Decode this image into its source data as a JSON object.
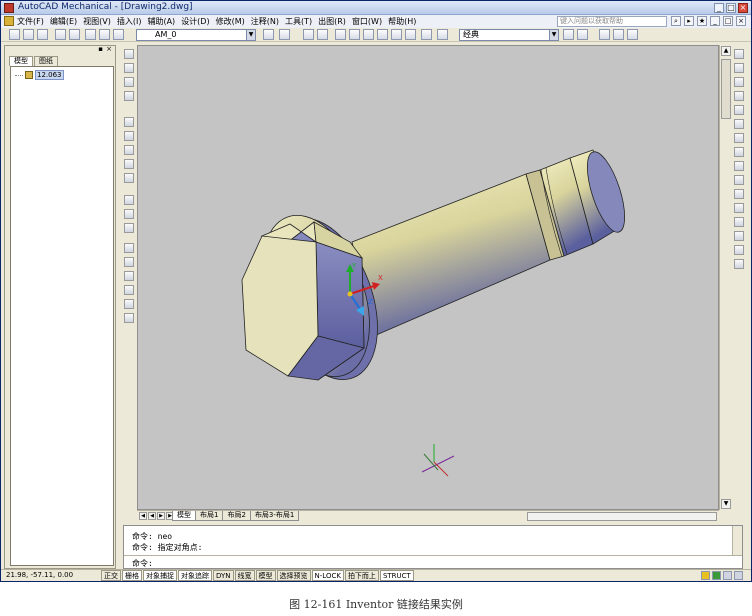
{
  "window": {
    "title": "AutoCAD Mechanical - [Drawing2.dwg]",
    "controls": [
      "_",
      "□",
      "×"
    ]
  },
  "menubar": {
    "items": [
      "文件(F)",
      "编辑(E)",
      "视图(V)",
      "插入(I)",
      "辅助(A)",
      "设计(D)",
      "修改(M)",
      "注释(N)",
      "工具(T)",
      "出图(R)",
      "窗口(W)",
      "帮助(H)"
    ],
    "help_placeholder": "键入问题以获取帮助"
  },
  "toolbar": {
    "layer_value": "AM_0",
    "workspace_value": "经典"
  },
  "browser": {
    "tabs": [
      "模型",
      "图纸"
    ],
    "tree_item": "12.063"
  },
  "layout_tabs": [
    "模型",
    "布局1",
    "布局2",
    "布局3-布局1"
  ],
  "command": {
    "lines": [
      "命令:  neo",
      "命令: 指定对角点:"
    ],
    "prompt": "命令:"
  },
  "status": {
    "coords": "21.98, -57.11, 0.00",
    "buttons": [
      "正交",
      "栅格",
      "对象捕捉",
      "对象追踪",
      "DYN",
      "线宽",
      "模型",
      "选择预览",
      "N-LOCK",
      "拍下而上",
      "STRUCT"
    ]
  },
  "caption": "图 12-161 Inventor 链接结果实例"
}
